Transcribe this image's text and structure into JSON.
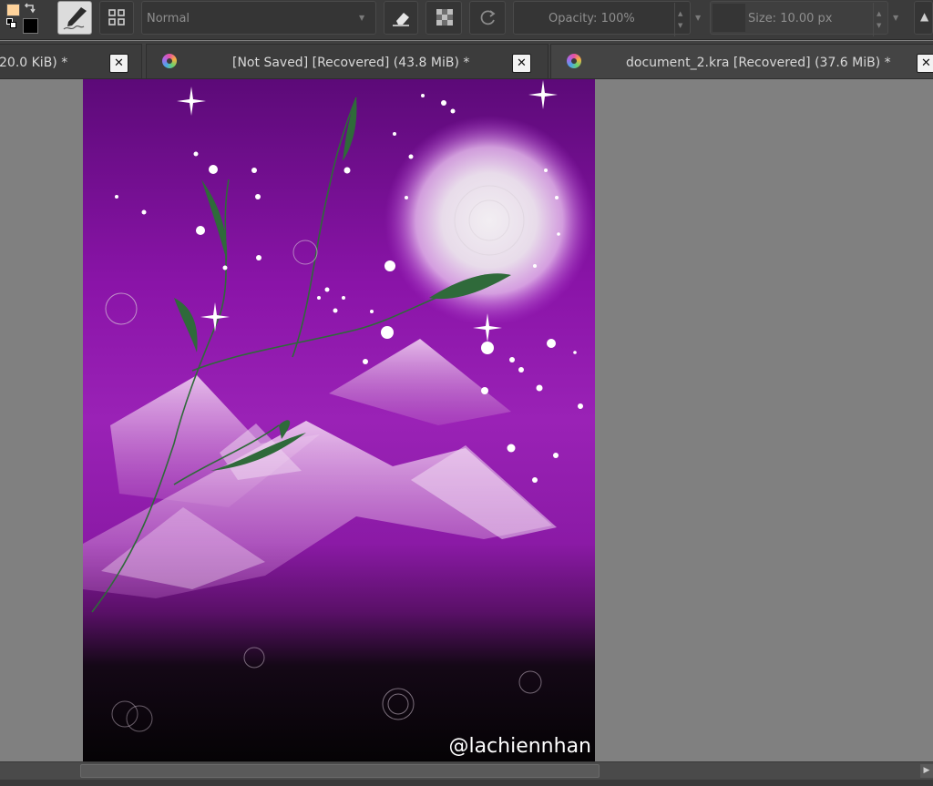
{
  "toolbar": {
    "blend_mode": "Normal",
    "opacity": "Opacity: 100%",
    "size": "Size: 10.00 px",
    "foreground_color": "#ffd39b",
    "background_color": "#000000",
    "icons": [
      "color-swatch-icon",
      "swap-colors-icon",
      "brush-preset-icon",
      "brush-presets-grid-icon",
      "eraser-icon",
      "alpha-lock-icon",
      "reload-preset-icon"
    ]
  },
  "tabs": [
    {
      "label": "20.0 KiB) *",
      "close": "✕"
    },
    {
      "label": "[Not Saved]  [Recovered]  (43.8 MiB) *",
      "close": "✕"
    },
    {
      "label": "document_2.kra [Recovered]  (37.6 MiB) *",
      "close": "✕"
    }
  ],
  "canvas": {
    "signature": "@lachiennhan",
    "colors": {
      "sky_top": "#5c0a78",
      "sky_mid": "#9a22b6",
      "ground": "#050305",
      "moon": "#f2eef2",
      "stem": "#2f6a3a"
    }
  }
}
